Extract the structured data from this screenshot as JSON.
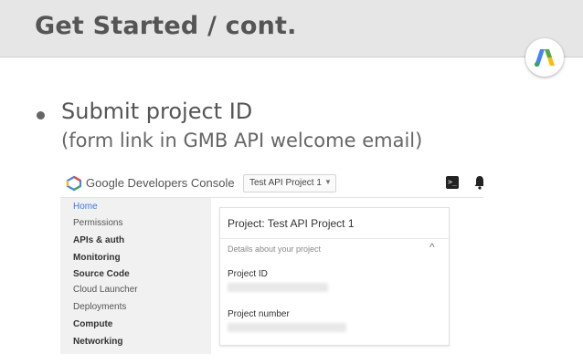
{
  "slide": {
    "title": "Get Started / cont.",
    "bullet": "Submit project ID",
    "sub_bullet": "(form link in GMB API welcome email)"
  },
  "colors": {
    "header_bg": "#e6e6e6",
    "title_text": "#555555",
    "ads_blue": "#4285f4",
    "ads_yellow": "#fbbc04",
    "ads_green": "#34a853",
    "console_link": "#3b78e7"
  },
  "console": {
    "product_name": "Google Developers Console",
    "project_selector": "Test API Project 1",
    "sidebar": [
      {
        "label": "Home",
        "style": "active"
      },
      {
        "label": "Permissions",
        "style": "normal"
      },
      {
        "label": "APIs & auth",
        "style": "bold"
      },
      {
        "label": "Monitoring",
        "style": "bold"
      },
      {
        "label": "Source Code",
        "style": "bold"
      },
      {
        "label": "Cloud Launcher",
        "style": "normal"
      },
      {
        "label": "Deployments",
        "style": "normal"
      },
      {
        "label": "Compute",
        "style": "bold"
      },
      {
        "label": "Networking",
        "style": "bold"
      }
    ],
    "card": {
      "title": "Project: Test API Project 1",
      "details": "Details about your project",
      "project_id_label": "Project ID",
      "project_number_label": "Project number"
    },
    "icons": [
      "google-developers-logo-icon",
      "chevron-down-icon",
      "terminal-icon",
      "notifications-icon",
      "chevron-up-icon"
    ]
  },
  "logo": {
    "icon": "google-adwords-logo-icon"
  }
}
